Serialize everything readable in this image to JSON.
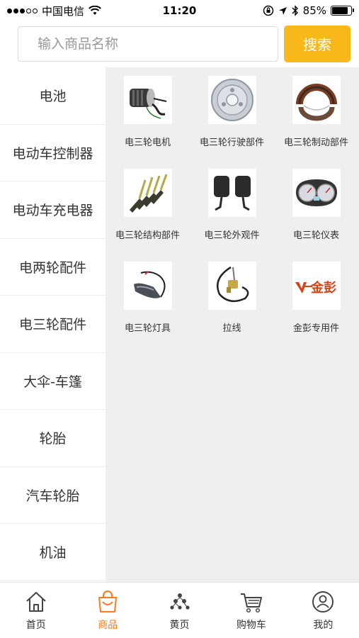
{
  "status_bar": {
    "carrier": "中国电信",
    "time": "11:20",
    "battery_text": "85%",
    "battery_level": 0.85
  },
  "search": {
    "placeholder": "输入商品名称",
    "button_label": "搜索",
    "accent_color": "#f8b81a"
  },
  "sidebar": {
    "active_index": 4,
    "active_color": "#ff7a1c",
    "items": [
      {
        "label": "电池"
      },
      {
        "label": "电动车控制器"
      },
      {
        "label": "电动车充电器"
      },
      {
        "label": "电两轮配件"
      },
      {
        "label": "电三轮配件"
      },
      {
        "label": "大伞-车篷"
      },
      {
        "label": "轮胎"
      },
      {
        "label": "汽车轮胎"
      },
      {
        "label": "机油"
      }
    ]
  },
  "products": [
    {
      "name": "电三轮电机",
      "icon": "motor-icon"
    },
    {
      "name": "电三轮行驶部件",
      "icon": "wheel-rim-icon"
    },
    {
      "name": "电三轮制动部件",
      "icon": "brake-shoe-icon"
    },
    {
      "name": "电三轮结构部件",
      "icon": "brackets-icon"
    },
    {
      "name": "电三轮外观件",
      "icon": "mirrors-icon"
    },
    {
      "name": "电三轮仪表",
      "icon": "dashboard-gauge-icon"
    },
    {
      "name": "电三轮灯具",
      "icon": "turn-signal-icon"
    },
    {
      "name": "拉线",
      "icon": "cable-icon"
    },
    {
      "name": "金彭专用件",
      "icon": "jinpeng-logo",
      "logo_text": "金彭"
    }
  ],
  "tabbar": {
    "active_index": 1,
    "items": [
      {
        "label": "首页",
        "icon": "home-icon"
      },
      {
        "label": "商品",
        "icon": "shopping-bag-icon"
      },
      {
        "label": "黄页",
        "icon": "yellow-pages-icon"
      },
      {
        "label": "购物车",
        "icon": "cart-icon"
      },
      {
        "label": "我的",
        "icon": "profile-icon"
      }
    ]
  }
}
